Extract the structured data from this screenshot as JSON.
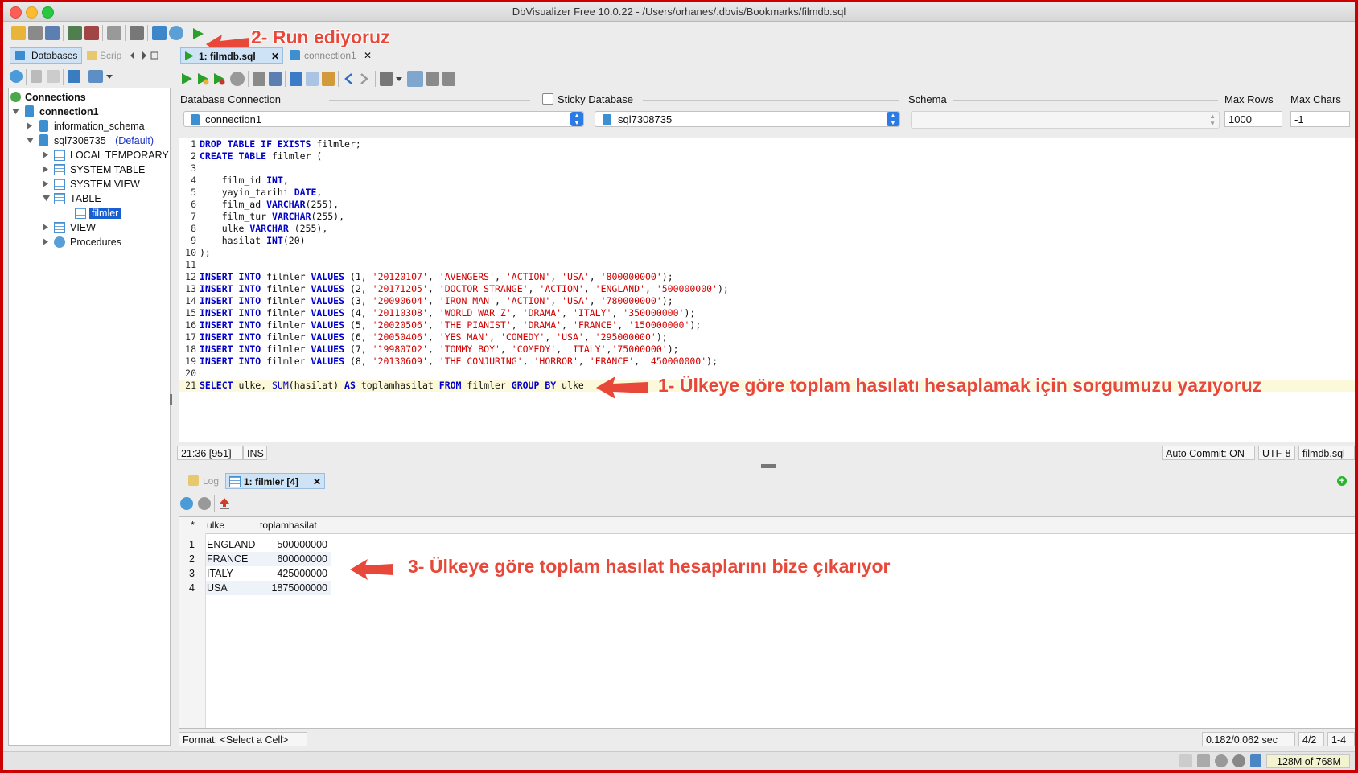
{
  "window": {
    "title": "DbVisualizer Free 10.0.22 - /Users/orhanes/.dbvis/Bookmarks/filmdb.sql"
  },
  "annotations": {
    "run": "2- Run ediyoruz",
    "query": "1- Ülkeye göre toplam hasılatı hesaplamak için sorgumuzu yazıyoruz",
    "result": "3- Ülkeye göre toplam hasılat hesaplarını bize çıkarıyor"
  },
  "left_tabs": {
    "databases": "Databases",
    "scripts": "Scrip"
  },
  "tree": {
    "root": "Connections",
    "connection": "connection1",
    "info_schema": "information_schema",
    "db": "sql7308735",
    "db_default": "(Default)",
    "local_temp": "LOCAL TEMPORARY",
    "system_table": "SYSTEM TABLE",
    "system_view": "SYSTEM VIEW",
    "table": "TABLE",
    "filmler": "filmler",
    "view": "VIEW",
    "procedures": "Procedures"
  },
  "editor_tabs": {
    "active": "1: filmdb.sql",
    "inactive": "connection1"
  },
  "connection_bar": {
    "db_conn_label": "Database Connection",
    "sticky_label": "Sticky Database",
    "schema_label": "Schema",
    "max_rows_label": "Max Rows",
    "max_chars_label": "Max Chars",
    "connection_value": "connection1",
    "database_value": "sql7308735",
    "max_rows_value": "1000",
    "max_chars_value": "-1"
  },
  "status": {
    "position": "21:36 [951]",
    "mode": "INS",
    "autocommit": "Auto Commit: ON",
    "encoding": "UTF-8",
    "file": "filmdb.sql"
  },
  "result_tabs": {
    "log": "Log",
    "result": "1: filmler [4]"
  },
  "result_table": {
    "corner": "*",
    "columns": [
      "ulke",
      "toplamhasilat"
    ],
    "rows": [
      {
        "n": "1",
        "ulke": "ENGLAND",
        "total": "500000000"
      },
      {
        "n": "2",
        "ulke": "FRANCE",
        "total": "600000000"
      },
      {
        "n": "3",
        "ulke": "ITALY",
        "total": "425000000"
      },
      {
        "n": "4",
        "ulke": "USA",
        "total": "1875000000"
      }
    ]
  },
  "result_status": {
    "format": "Format: <Select a Cell>",
    "timing": "0.182/0.062 sec",
    "ratio": "4/2",
    "range": "1-4"
  },
  "memory": "128M of 768M"
}
